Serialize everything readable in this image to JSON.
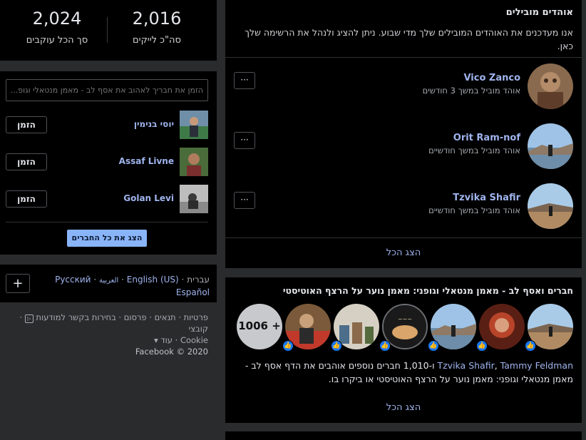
{
  "stats": {
    "likes_value": "2,016",
    "likes_label": "סה\"כ לייקים",
    "followers_value": "2,024",
    "followers_label": "סך הכל עוקבים"
  },
  "invite": {
    "search_placeholder": "הזמן את חבריך לאהוב את אסף לב - מאמן מנטאלי וגופ...",
    "friends": [
      {
        "name": "יוסי בנימין",
        "button": "הזמן"
      },
      {
        "name": "Assaf Livne",
        "button": "הזמן"
      },
      {
        "name": "Golan Levi",
        "button": "הזמן"
      }
    ],
    "show_all": "הצג את כל החברים"
  },
  "languages": {
    "current": "עברית",
    "others": [
      "English (US)",
      "العربية",
      "Русский",
      "Español"
    ],
    "sep": "·",
    "plus": "+"
  },
  "footer": {
    "links": [
      "פרטיות",
      "תנאים",
      "פרסום",
      "בחירות בקשר למודעות",
      "קובצי"
    ],
    "sep": "·",
    "cookie": "Cookie",
    "more": "עוד ▾",
    "copyright": "Facebook © 2020"
  },
  "top_fans": {
    "title": "אוהדים מובילים",
    "description": "אנו מעדכנים את האוהדים המובילים שלך מדי שבוע. ניתן להציג ולנהל את הרשימה שלך כאן.",
    "fans": [
      {
        "name": "Vico Zanco",
        "subtitle": "אוהד מוביל במשך 3 חודשים",
        "menu": "···"
      },
      {
        "name": "Orit Ram-nof",
        "subtitle": "אוהד מוביל במשך חודשיים",
        "menu": "···"
      },
      {
        "name": "Tzvika Shafir",
        "subtitle": "אוהד מוביל במשך חודשיים",
        "menu": "···"
      }
    ],
    "see_all": "הצג הכל"
  },
  "friends_like": {
    "title": "חברים ואסף לב - מאמן מנטאלי וגופני: מאמן נוער על הרצף האוטיסטי",
    "more_count": "1006 +",
    "like_icon": "👍",
    "name1": "Tzvika Shafir",
    "name2": "Tammy Feldman",
    "sentence": "ו-1,010 חברים נוספים אוהבים את הדף אסף לב - מאמן מנטאלי וגופני: מאמן נוער על הרצף האוטיסטי או ביקרו בו.",
    "see_all": "הצג הכל"
  }
}
